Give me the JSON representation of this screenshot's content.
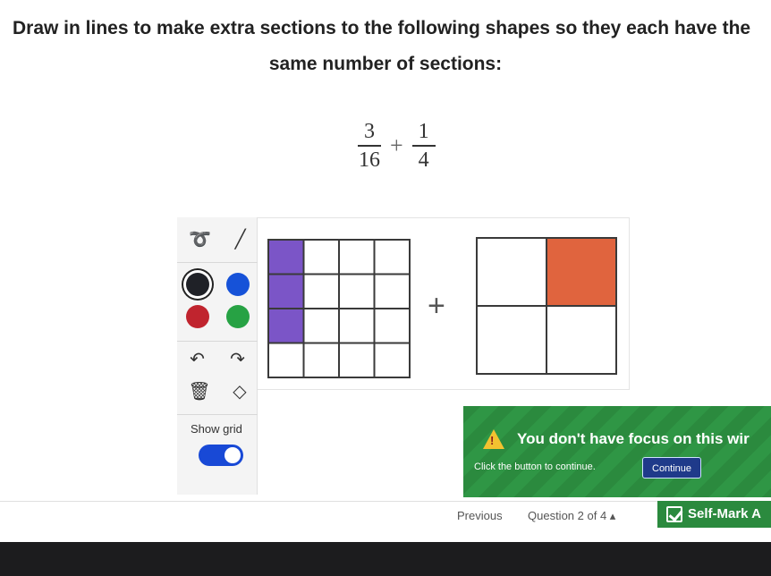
{
  "question": {
    "instruction_line1": "Draw in lines to make extra sections to the following shapes so they each have the",
    "instruction_line2": "same number of sections:",
    "fraction_a": {
      "numerator": "3",
      "denominator": "16"
    },
    "operator": "+",
    "fraction_b": {
      "numerator": "1",
      "denominator": "4"
    }
  },
  "toolbar": {
    "colors": [
      {
        "name": "black",
        "hex": "#1f2127",
        "selected": true
      },
      {
        "name": "blue",
        "hex": "#1652d8",
        "selected": false
      },
      {
        "name": "red",
        "hex": "#c0242e",
        "selected": false
      },
      {
        "name": "green",
        "hex": "#27a244",
        "selected": false
      }
    ],
    "show_grid_label": "Show grid",
    "show_grid_on": true
  },
  "shapes": {
    "operator": "+",
    "grid_shape": {
      "rows": 4,
      "cols": 4,
      "shaded_cells": [
        [
          0,
          0
        ],
        [
          1,
          0
        ],
        [
          2,
          0
        ]
      ],
      "shade_color": "#7b55c7"
    },
    "quad_shape": {
      "rows": 2,
      "cols": 2,
      "shaded_cells": [
        [
          0,
          1
        ]
      ],
      "shade_color": "#e0643e"
    }
  },
  "focus_banner": {
    "message": "You don't have focus on this wir",
    "sub": "Click the button to continue.",
    "button": "Continue"
  },
  "footer": {
    "previous": "Previous",
    "question_counter": "Question 2 of 4 ▴",
    "self_mark": "Self-Mark A"
  }
}
